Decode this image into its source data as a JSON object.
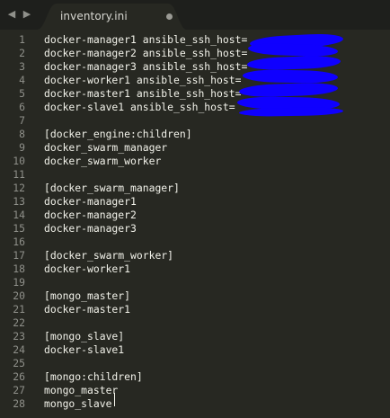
{
  "nav": {
    "back_icon": "◀",
    "forward_icon": "▶"
  },
  "tab": {
    "title": "inventory.ini",
    "dirty": true
  },
  "lines": [
    {
      "num": "1",
      "text": "docker-manager1 ansible_ssh_host="
    },
    {
      "num": "2",
      "text": "docker-manager2 ansible_ssh_host="
    },
    {
      "num": "3",
      "text": "docker-manager3 ansible_ssh_host="
    },
    {
      "num": "4",
      "text": "docker-worker1 ansible_ssh_host="
    },
    {
      "num": "5",
      "text": "docker-master1 ansible_ssh_host="
    },
    {
      "num": "6",
      "text": "docker-slave1 ansible_ssh_host="
    },
    {
      "num": "7",
      "text": ""
    },
    {
      "num": "8",
      "text": "[docker_engine:children]"
    },
    {
      "num": "9",
      "text": "docker_swarm_manager"
    },
    {
      "num": "10",
      "text": "docker_swarm_worker"
    },
    {
      "num": "11",
      "text": ""
    },
    {
      "num": "12",
      "text": "[docker_swarm_manager]"
    },
    {
      "num": "13",
      "text": "docker-manager1"
    },
    {
      "num": "14",
      "text": "docker-manager2"
    },
    {
      "num": "15",
      "text": "docker-manager3"
    },
    {
      "num": "16",
      "text": ""
    },
    {
      "num": "17",
      "text": "[docker_swarm_worker]"
    },
    {
      "num": "18",
      "text": "docker-worker1"
    },
    {
      "num": "19",
      "text": ""
    },
    {
      "num": "20",
      "text": "[mongo_master]"
    },
    {
      "num": "21",
      "text": "docker-master1"
    },
    {
      "num": "22",
      "text": ""
    },
    {
      "num": "23",
      "text": "[mongo_slave]"
    },
    {
      "num": "24",
      "text": "docker-slave1"
    },
    {
      "num": "25",
      "text": ""
    },
    {
      "num": "26",
      "text": "[mongo:children]"
    },
    {
      "num": "27",
      "text": "mongo_master"
    },
    {
      "num": "28",
      "text": "mongo_slave"
    }
  ],
  "colors": {
    "background": "#272822",
    "gutter_text": "#8f908a",
    "code_text": "#f2f2ea",
    "redaction": "#0f00ff"
  }
}
